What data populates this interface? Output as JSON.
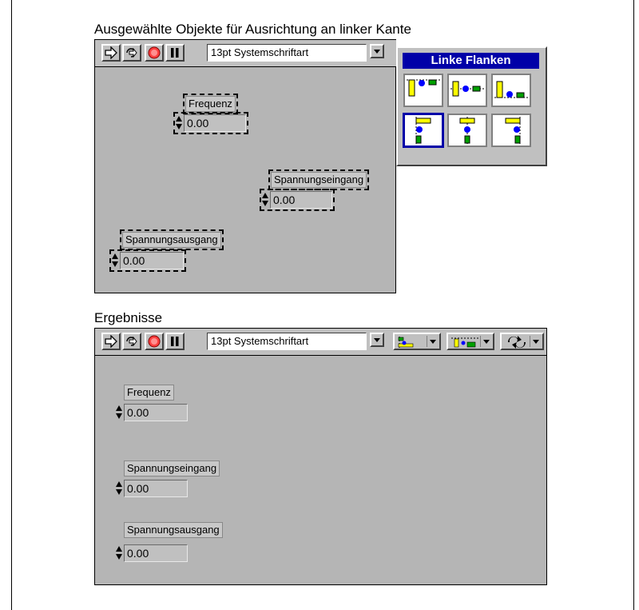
{
  "top_caption": "Ausgewählte Objekte für Ausrichtung an linker Kante",
  "bottom_caption": "Ergebnisse",
  "toolbar": {
    "font_value": "13pt Systemschriftart",
    "buttons": [
      "run-arrow",
      "run-continuously",
      "abort",
      "pause"
    ]
  },
  "palette": {
    "title": "Linke Flanken",
    "options": [
      "top-edges",
      "vertical-centers",
      "bottom-edges",
      "left-edges",
      "horizontal-centers",
      "right-edges"
    ],
    "selected": "left-edges"
  },
  "top_controls": [
    {
      "label": "Frequenz",
      "value": "0.00"
    },
    {
      "label": "Spannungseingang",
      "value": "0.00"
    },
    {
      "label": "Spannungsausgang",
      "value": "0.00"
    }
  ],
  "bottom_controls": [
    {
      "label": "Frequenz",
      "value": "0.00"
    },
    {
      "label": "Spannungseingang",
      "value": "0.00"
    },
    {
      "label": "Spannungsausgang",
      "value": "0.00"
    }
  ],
  "colors": {
    "panel": "#b5b5b5",
    "toolbar": "#c0c0c0",
    "palette_title": "#0000a8",
    "object_blue": "#0000ff",
    "object_yellow": "#ffff00",
    "object_green": "#00a000"
  }
}
